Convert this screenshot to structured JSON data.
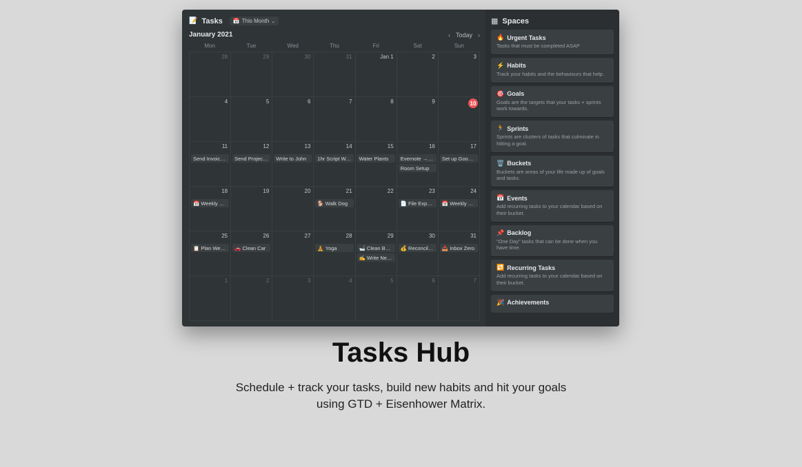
{
  "hero": {
    "title": "Tasks Hub",
    "subtitle_line1": "Schedule + track your tasks, build new habits and hit your goals",
    "subtitle_line2": "using GTD + Eisenhower Matrix."
  },
  "calendar": {
    "tab_icon": "📝",
    "tab_title": "Tasks",
    "filter_icon": "📅",
    "filter_label": "This Month",
    "month_label": "January 2021",
    "nav": {
      "prev": "‹",
      "today": "Today",
      "next": "›"
    },
    "weekdays": [
      "Mon",
      "Tue",
      "Wed",
      "Thu",
      "Fri",
      "Sat",
      "Sun"
    ],
    "today_day": 10,
    "cells": [
      {
        "num": "28",
        "dim": true
      },
      {
        "num": "29",
        "dim": true
      },
      {
        "num": "30",
        "dim": true
      },
      {
        "num": "31",
        "dim": true
      },
      {
        "num": "Jan 1"
      },
      {
        "num": "2"
      },
      {
        "num": "3"
      },
      {
        "num": "4"
      },
      {
        "num": "5"
      },
      {
        "num": "6"
      },
      {
        "num": "7"
      },
      {
        "num": "8"
      },
      {
        "num": "9"
      },
      {
        "num": "10",
        "today": true
      },
      {
        "num": "11",
        "tasks": [
          {
            "label": "Send Invoice …"
          }
        ]
      },
      {
        "num": "12",
        "tasks": [
          {
            "label": "Send Project …"
          }
        ]
      },
      {
        "num": "13",
        "tasks": [
          {
            "label": "Write to John"
          }
        ]
      },
      {
        "num": "14",
        "tasks": [
          {
            "label": "1hr Script Wri…"
          }
        ]
      },
      {
        "num": "15",
        "tasks": [
          {
            "label": "Water Plants"
          }
        ]
      },
      {
        "num": "16",
        "tasks": [
          {
            "label": "Evernote → N…"
          },
          {
            "label": "Room Setup"
          }
        ]
      },
      {
        "num": "17",
        "tasks": [
          {
            "label": "Set up Googl…"
          }
        ]
      },
      {
        "num": "18",
        "tasks": [
          {
            "icon": "📅",
            "label": "Weekly Ca…"
          }
        ]
      },
      {
        "num": "19"
      },
      {
        "num": "20"
      },
      {
        "num": "21",
        "tasks": [
          {
            "icon": "🐕",
            "label": "Walk Dog"
          }
        ]
      },
      {
        "num": "22"
      },
      {
        "num": "23",
        "tasks": [
          {
            "icon": "📄",
            "label": "File Expen…"
          }
        ]
      },
      {
        "num": "24",
        "tasks": [
          {
            "icon": "📅",
            "label": "Weekly Re…"
          }
        ]
      },
      {
        "num": "25",
        "tasks": [
          {
            "icon": "📋",
            "label": "Plan Week…"
          }
        ]
      },
      {
        "num": "26",
        "tasks": [
          {
            "icon": "🚗",
            "label": "Clean Car"
          }
        ]
      },
      {
        "num": "27"
      },
      {
        "num": "28",
        "tasks": [
          {
            "icon": "🧘",
            "label": "Yoga"
          }
        ]
      },
      {
        "num": "29",
        "tasks": [
          {
            "icon": "🛁",
            "label": "Clean Bath…"
          },
          {
            "icon": "✍️",
            "label": "Write New…"
          }
        ]
      },
      {
        "num": "30",
        "tasks": [
          {
            "icon": "💰",
            "label": "Reconcile …"
          }
        ]
      },
      {
        "num": "31",
        "tasks": [
          {
            "icon": "📥",
            "label": "Inbox Zero"
          }
        ]
      },
      {
        "num": "1",
        "dim": true
      },
      {
        "num": "2",
        "dim": true
      },
      {
        "num": "3",
        "dim": true
      },
      {
        "num": "4",
        "dim": true
      },
      {
        "num": "5",
        "dim": true
      },
      {
        "num": "6",
        "dim": true
      },
      {
        "num": "7",
        "dim": true
      }
    ]
  },
  "spaces": {
    "title": "Spaces",
    "cards": [
      {
        "icon": "🔥",
        "title": "Urgent Tasks",
        "desc": "Tasks that must be completed ASAP"
      },
      {
        "icon": "⚡",
        "title": "Habits",
        "desc": "Track your habits and the behaviours that help."
      },
      {
        "icon": "🎯",
        "title": "Goals",
        "desc": "Goals are the targets that your tasks + sprints work towards."
      },
      {
        "icon": "🏃",
        "title": "Sprints",
        "desc": "Sprints are clusters of tasks that culminate in hitting a goal."
      },
      {
        "icon": "🗑️",
        "title": "Buckets",
        "desc": "Buckets are areas of your life made up of goals and tasks."
      },
      {
        "icon": "📅",
        "title": "Events",
        "desc": "Add recurring tasks to your calendar based on their bucket."
      },
      {
        "icon": "📌",
        "title": "Backlog",
        "desc": "“One Day” tasks that can be done when you have time."
      },
      {
        "icon": "🔁",
        "title": "Recurring Tasks",
        "desc": "Add recurring tasks to your calendar based on their bucket."
      },
      {
        "icon": "🎉",
        "title": "Achievements",
        "desc": ""
      }
    ]
  }
}
